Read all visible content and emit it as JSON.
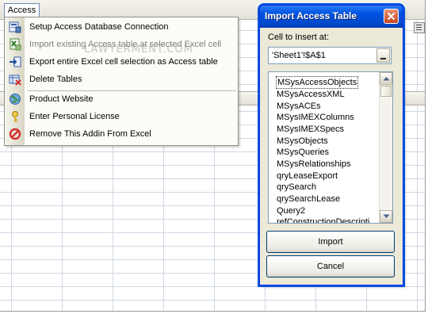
{
  "menu": {
    "title": "Access",
    "items": [
      {
        "label": "Setup Access Database Connection",
        "icon": "database-connection-icon",
        "enabled": true
      },
      {
        "label": "Import existing Access table at selected Excel cell",
        "icon": "import-excel-icon",
        "enabled": false
      },
      {
        "label": "Export entire Excel cell selection as Access table",
        "icon": "export-icon",
        "enabled": true
      },
      {
        "label": "Delete Tables",
        "icon": "delete-tables-icon",
        "enabled": true
      },
      {
        "label": "Product Website",
        "icon": "globe-icon",
        "enabled": true
      },
      {
        "label": "Enter Personal License",
        "icon": "key-icon",
        "enabled": true
      },
      {
        "label": "Remove This Addin From Excel",
        "icon": "no-entry-icon",
        "enabled": true
      }
    ]
  },
  "watermark": "LAWYERMENT.COM",
  "dialog": {
    "title": "Import Access Table",
    "cell_label": "Cell to Insert at:",
    "cell_value": "'Sheet1'!$A$1",
    "tables": [
      "MSysAccessObjects",
      "MSysAccessXML",
      "MSysACEs",
      "MSysIMEXColumns",
      "MSysIMEXSpecs",
      "MSysObjects",
      "MSysQueries",
      "MSysRelationships",
      "qryLeaseExport",
      "qrySearch",
      "qrySearchLease",
      "Query2",
      "refConstructionDescripti"
    ],
    "selected_table": "MSysAccessObjects",
    "import_label": "Import",
    "cancel_label": "Cancel"
  },
  "colors": {
    "titlebar": "#0054e3",
    "dialog_bg": "#ece9d8",
    "grid": "#d0d7e5",
    "close": "#c5451f"
  }
}
